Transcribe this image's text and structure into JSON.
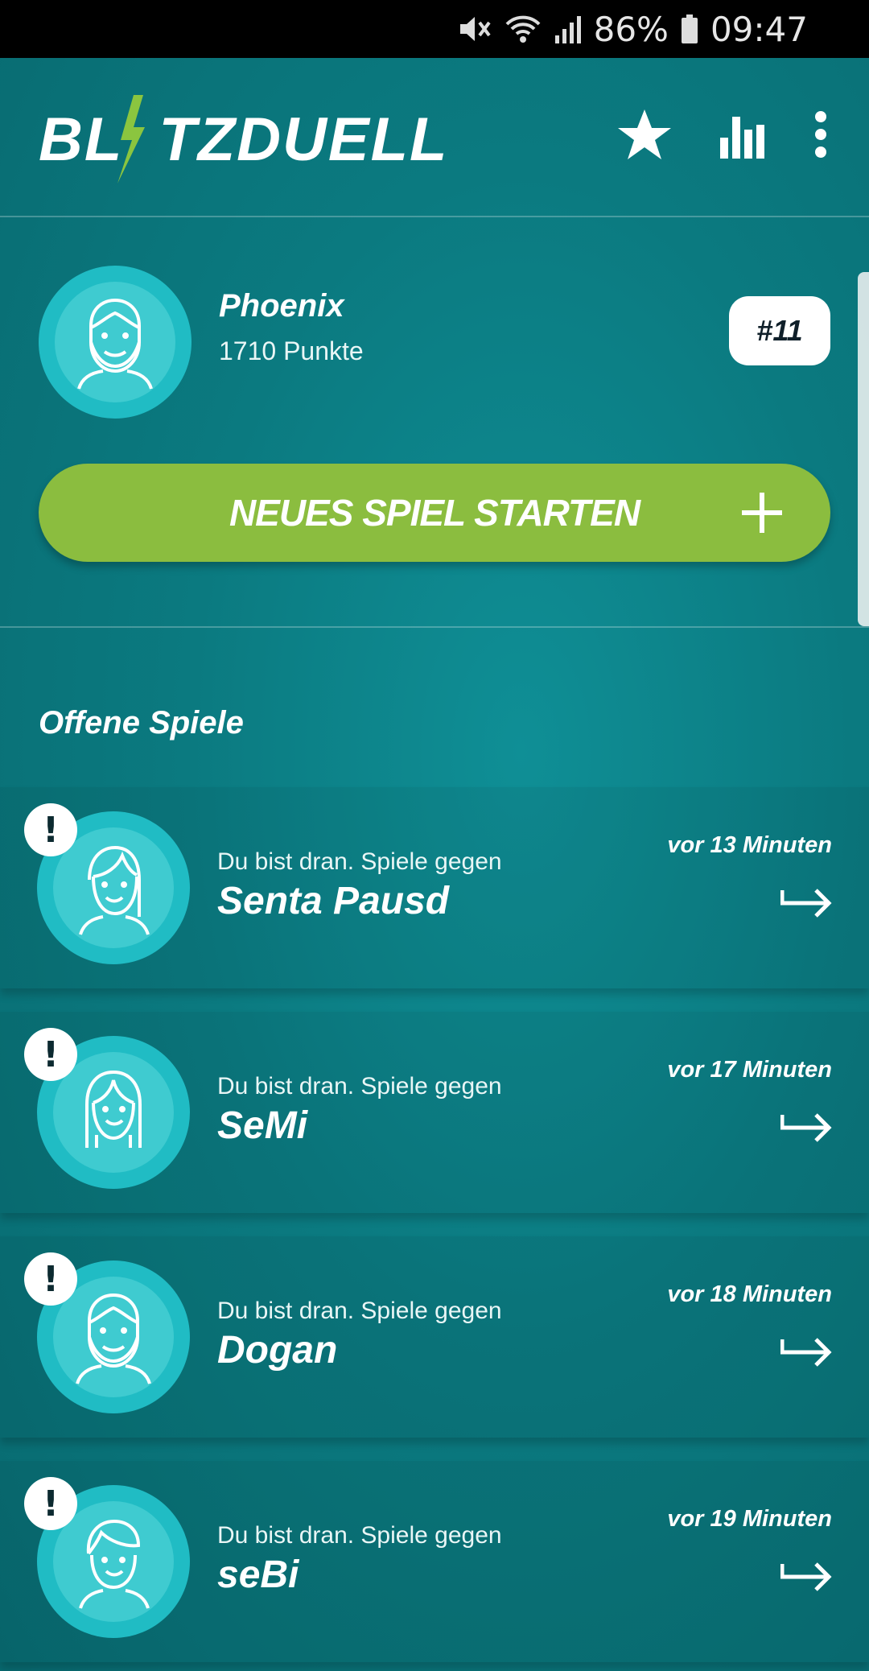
{
  "status_bar": {
    "battery": "86%",
    "time": "09:47",
    "icons": [
      "mute-icon",
      "wifi-icon",
      "signal-icon",
      "battery-icon"
    ]
  },
  "app_bar": {
    "logo": "BLITZDUELL",
    "logo_before": "BL",
    "logo_after": "TZDUELL",
    "actions": [
      "star-icon",
      "stats-icon",
      "more-vert-icon"
    ]
  },
  "profile": {
    "name": "Phoenix",
    "points": "1710 Punkte",
    "rank": "#11"
  },
  "new_game": {
    "label": "NEUES SPIEL STARTEN"
  },
  "open_games": {
    "title": "Offene Spiele",
    "items": [
      {
        "subtitle": "Du bist dran. Spiele gegen",
        "opponent": "Senta Pausd",
        "time": "vor 13 Minuten",
        "alert": "!"
      },
      {
        "subtitle": "Du bist dran. Spiele gegen",
        "opponent": "SeMi",
        "time": "vor 17 Minuten",
        "alert": "!"
      },
      {
        "subtitle": "Du bist dran. Spiele gegen",
        "opponent": "Dogan",
        "time": "vor 18 Minuten",
        "alert": "!"
      },
      {
        "subtitle": "Du bist dran. Spiele gegen",
        "opponent": "seBi",
        "time": "vor 19 Minuten",
        "alert": "!"
      }
    ]
  },
  "colors": {
    "background": "#0b7a80",
    "accent_green": "#8bbd3f",
    "avatar_bg": "#20bcc4",
    "bolt": "#8bc53f"
  }
}
